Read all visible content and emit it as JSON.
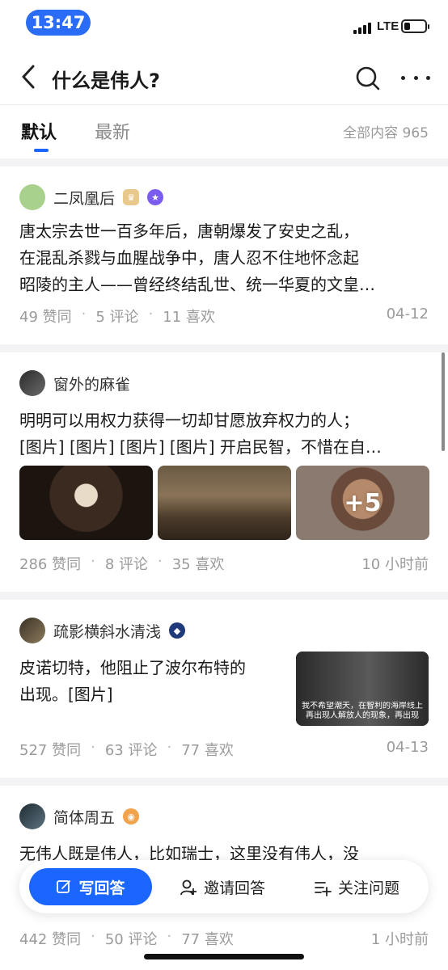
{
  "status": {
    "time": "13:47",
    "network": "LTE"
  },
  "header": {
    "title": "什么是伟人?"
  },
  "tabs": {
    "default": "默认",
    "latest": "最新",
    "total": "全部内容 965"
  },
  "colors": {
    "accent": "#1a66ff",
    "muted": "#9b9b9b"
  },
  "answers": [
    {
      "author": "二凤凰后",
      "text_lines": [
        "唐太宗去世一百多年后，唐朝爆发了安史之乱，",
        "在混乱杀戮与血腥战争中，唐人忍不住地怀念起",
        "昭陵的主人——曾经终结乱世、统一华夏的文皇…"
      ],
      "agree": "49 赞同",
      "comments": "5 评论",
      "likes": "11 喜欢",
      "time": "04-12"
    },
    {
      "author": "窗外的麻雀",
      "text_lines": [
        "明明可以用权力获得一切却甘愿放弃权力的人；",
        "[图片] [图片] [图片] [图片] 开启民智，不惜在自…"
      ],
      "more_images": "+5",
      "agree": "286 赞同",
      "comments": "8 评论",
      "likes": "35 喜欢",
      "time": "10 小时前"
    },
    {
      "author": "疏影横斜水清浅",
      "text_lines": [
        "皮诺切特，他阻止了波尔布特的",
        "出现。[图片]"
      ],
      "thumb_caption": [
        "我不希望潮天，在智利的海岸线上",
        "再出现人解放人的现象，再出现"
      ],
      "agree": "527 赞同",
      "comments": "63 评论",
      "likes": "77 喜欢",
      "time": "04-13"
    },
    {
      "author": "简体周五",
      "text_lines": [
        "无伟人既是伟人，比如瑞士，这里没有伟人，没"
      ],
      "agree": "442 赞同",
      "comments": "50 评论",
      "likes": "77 喜欢",
      "time": "1 小时前"
    }
  ],
  "bottom": {
    "write": "写回答",
    "invite": "邀请回答",
    "follow": "关注问题"
  },
  "separator": "·"
}
